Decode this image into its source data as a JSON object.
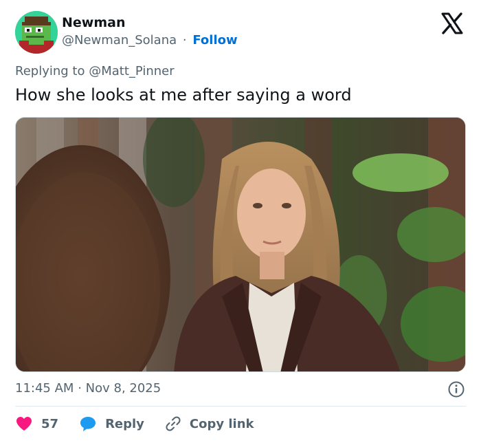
{
  "author": {
    "name": "Newman",
    "handle": "@Newman_Solana",
    "separator": "·",
    "follow_label": "Follow",
    "avatar_icon": "pixel-frog-avatar"
  },
  "reply": {
    "prefix": "Replying to ",
    "target": "@Matt_Pinner"
  },
  "tweet": {
    "text": "How she looks at me after saying a word",
    "media_icon": "photo-woman-brown-leather-jacket"
  },
  "meta": {
    "time": "11:45 AM",
    "separator": "·",
    "date": "Nov 8, 2025"
  },
  "actions": {
    "like_count": "57",
    "reply_label": "Reply",
    "copy_link_label": "Copy link"
  },
  "colors": {
    "like": "#f91880",
    "reply": "#1d9bf0",
    "follow": "#006fd6",
    "secondary_text": "#536471"
  }
}
